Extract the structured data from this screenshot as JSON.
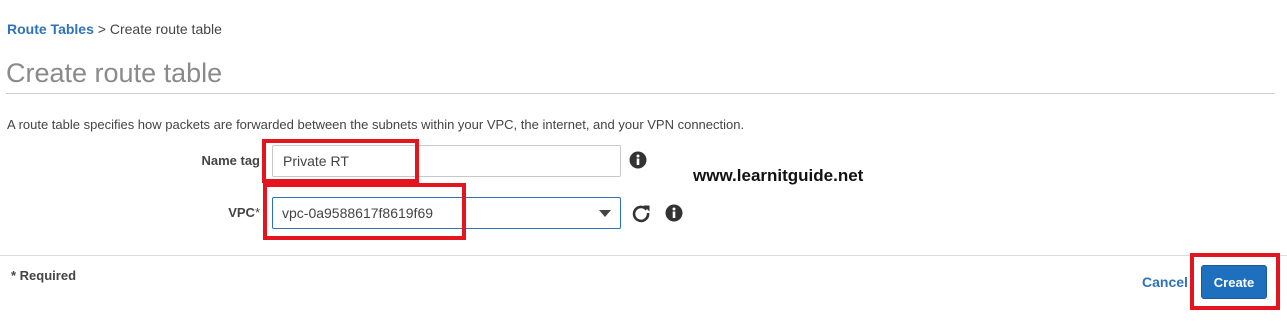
{
  "breadcrumb": {
    "link": "Route Tables",
    "separator": ">",
    "current": "Create route table"
  },
  "page": {
    "title": "Create route table",
    "description": "A route table specifies how packets are forwarded between the subnets within your VPC, the internet, and your VPN connection."
  },
  "form": {
    "name_tag": {
      "label": "Name tag",
      "value": "Private RT"
    },
    "vpc": {
      "label": "VPC",
      "required_mark": "*",
      "value": "vpc-0a9588617f8619f69"
    }
  },
  "watermark": "www.learnitguide.net",
  "footer": {
    "required_note": "* Required",
    "cancel_label": "Cancel",
    "create_label": "Create"
  },
  "colors": {
    "link": "#2e73b8",
    "primary_button": "#1f6fbf",
    "highlight": "#e4151f"
  },
  "icons": [
    "info-icon",
    "refresh-icon",
    "chevron-down-icon"
  ]
}
